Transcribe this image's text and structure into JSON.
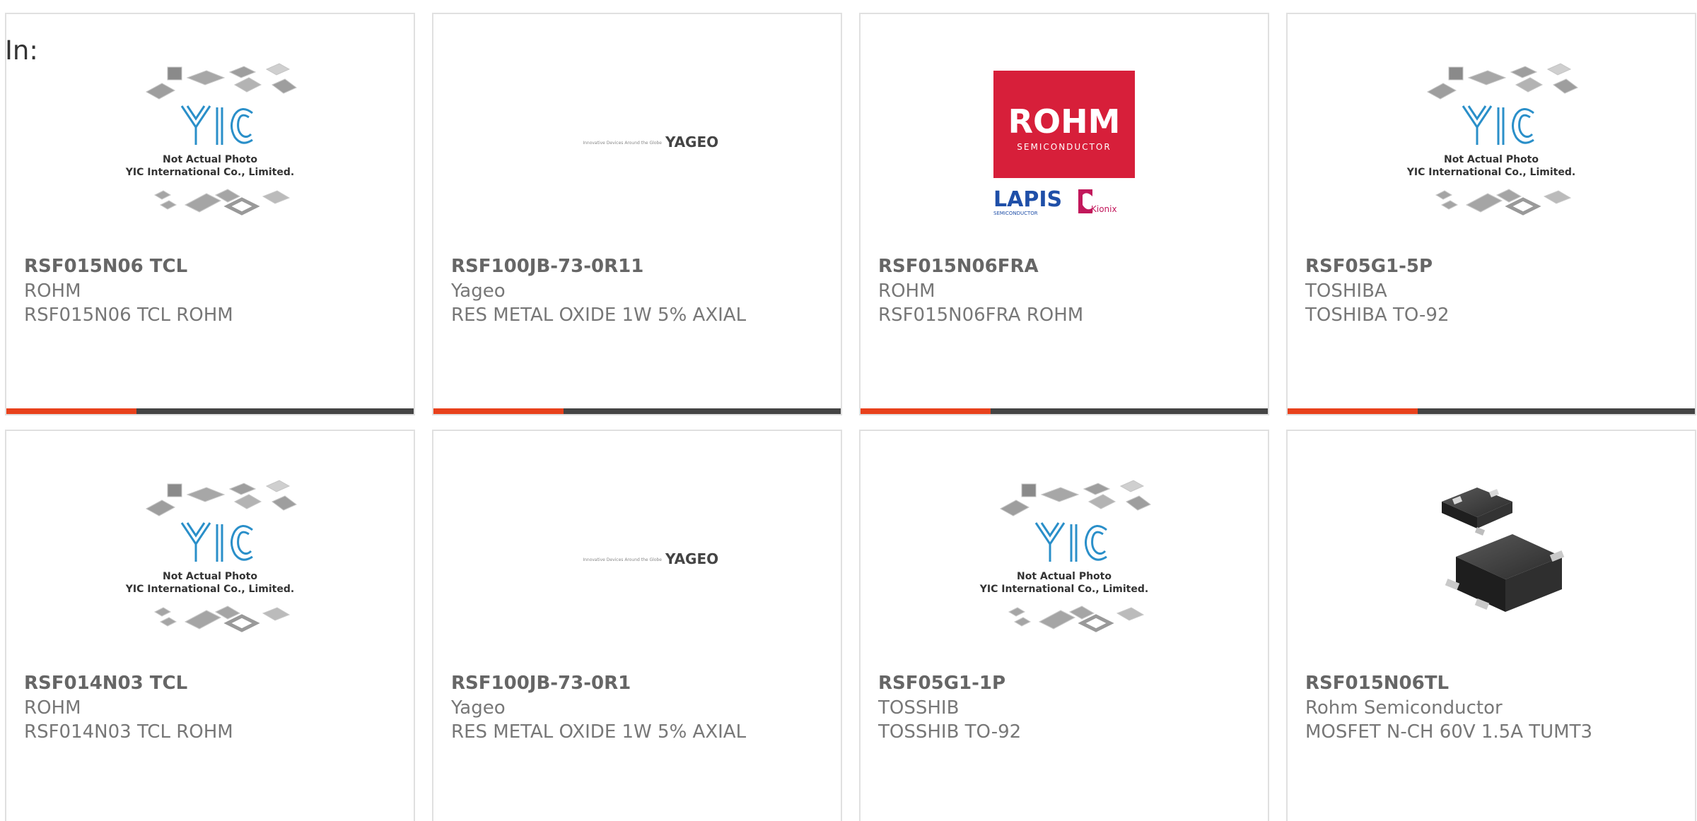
{
  "filter_prefix": "In:",
  "colors": {
    "accent": "#e8411c",
    "bar_dark": "#444444",
    "card_border": "#e0e0e0",
    "rohm_red": "#d71f3a",
    "lapis_blue": "#1f4fa8",
    "kionix_magenta": "#c2185b",
    "yic_blue": "#2a8fc9"
  },
  "products": [
    {
      "part_number": "RSF015N06 TCL",
      "manufacturer": "ROHM",
      "description": "RSF015N06 TCL ROHM",
      "image": "yic-placeholder-image",
      "placeholder_line1": "Not Actual Photo",
      "placeholder_line2": "YIC International Co., Limited.",
      "accent_fraction": 0.32
    },
    {
      "part_number": "RSF100JB-73-0R11",
      "manufacturer": "Yageo",
      "description": "RES METAL OXIDE 1W 5% AXIAL",
      "image": "yageo-logo",
      "logo_tagline": "Innovative Devices Around the Globe",
      "logo_text": "YAGEO",
      "accent_fraction": 0.32
    },
    {
      "part_number": "RSF015N06FRA",
      "manufacturer": "ROHM",
      "description": "RSF015N06FRA ROHM",
      "image": "rohm-logo",
      "logo_text": "ROHM",
      "logo_sub": "SEMICONDUCTOR",
      "lapis_text": "LAPIS",
      "lapis_sub": "SEMICONDUCTOR",
      "kionix_text": "Kionix",
      "accent_fraction": 0.32
    },
    {
      "part_number": "RSF05G1-5P",
      "manufacturer": "TOSHIBA",
      "description": "TOSHIBA TO-92",
      "image": "yic-placeholder-image",
      "placeholder_line1": "Not Actual Photo",
      "placeholder_line2": "YIC International Co., Limited.",
      "accent_fraction": 0.32
    },
    {
      "part_number": "RSF014N03 TCL",
      "manufacturer": "ROHM",
      "description": "RSF014N03 TCL ROHM",
      "image": "yic-placeholder-image",
      "placeholder_line1": "Not Actual Photo",
      "placeholder_line2": "YIC International Co., Limited."
    },
    {
      "part_number": "RSF100JB-73-0R1",
      "manufacturer": "Yageo",
      "description": "RES METAL OXIDE 1W 5% AXIAL",
      "image": "yageo-logo",
      "logo_tagline": "Innovative Devices Around the Globe",
      "logo_text": "YAGEO"
    },
    {
      "part_number": "RSF05G1-1P",
      "manufacturer": "TOSSHIB",
      "description": "TOSSHIB TO-92",
      "image": "yic-placeholder-image",
      "placeholder_line1": "Not Actual Photo",
      "placeholder_line2": "YIC International Co., Limited."
    },
    {
      "part_number": "RSF015N06TL",
      "manufacturer": "Rohm Semiconductor",
      "description": "MOSFET N-CH 60V 1.5A TUMT3",
      "image": "sot-package-photo"
    }
  ]
}
